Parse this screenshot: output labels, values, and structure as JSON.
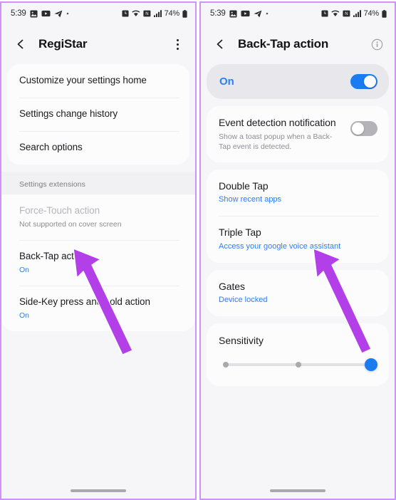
{
  "theme": {
    "accent_blue": "#2e7cf6",
    "toggle_on": "#1a7cf0",
    "toggle_off": "#b3b3b8",
    "annotation_arrow": "#b23fe8",
    "phone_border": "#cf93f5",
    "page_bg": "#f6f6f8",
    "card_bg": "#fcfcfd"
  },
  "left_phone": {
    "status_bar": {
      "clock": "5:39",
      "left_icons": [
        "gallery-icon",
        "youtube-icon",
        "telegram-icon",
        "dot-icon"
      ],
      "right_icons": [
        "alarm-icon",
        "wifi-icon",
        "nfc-icon",
        "signal-icon"
      ],
      "battery_text": "74%",
      "battery_icon": "battery-icon"
    },
    "app_bar": {
      "back_icon": "chevron-left-icon",
      "title": "RegiStar",
      "overflow_icon": "kebab-menu-icon"
    },
    "card1_rows": [
      {
        "title": "Customize your settings home"
      },
      {
        "title": "Settings change history"
      },
      {
        "title": "Search options"
      }
    ],
    "section_label": "Settings extensions",
    "card2_rows": [
      {
        "title": "Force-Touch action",
        "subtitle": "Not supported on cover screen",
        "disabled": true
      },
      {
        "title": "Back-Tap action",
        "subtitle": "On",
        "subtitle_style": "blue"
      },
      {
        "title": "Side-Key press and hold action",
        "subtitle": "On",
        "subtitle_style": "blue"
      }
    ],
    "gesture_bar": "home-gesture-bar"
  },
  "right_phone": {
    "status_bar": {
      "clock": "5:39",
      "left_icons": [
        "gallery-icon",
        "youtube-icon",
        "telegram-icon",
        "dot-icon"
      ],
      "right_icons": [
        "alarm-icon",
        "wifi-icon",
        "nfc-icon",
        "signal-icon"
      ],
      "battery_text": "74%",
      "battery_icon": "battery-icon"
    },
    "app_bar": {
      "back_icon": "chevron-left-icon",
      "title": "Back-Tap action",
      "info_icon": "info-circle-icon"
    },
    "master_switch": {
      "label": "On",
      "state": "on"
    },
    "event_row": {
      "title": "Event detection notification",
      "subtitle": "Show a toast popup when a Back-Tap event is detected.",
      "toggle_state": "off"
    },
    "tap_rows": [
      {
        "title": "Double Tap",
        "subtitle": "Show recent apps"
      },
      {
        "title": "Triple Tap",
        "subtitle": "Access your google voice assistant"
      }
    ],
    "gates_row": {
      "title": "Gates",
      "subtitle": "Device locked"
    },
    "sensitivity": {
      "title": "Sensitivity",
      "ticks": 3,
      "value": 3,
      "value_percent": 100
    },
    "gesture_bar": "home-gesture-bar"
  },
  "annotations": [
    {
      "name": "arrow-pointing-back-tap-action",
      "target": "Back-Tap action"
    },
    {
      "name": "arrow-pointing-triple-tap",
      "target": "Triple Tap"
    }
  ]
}
